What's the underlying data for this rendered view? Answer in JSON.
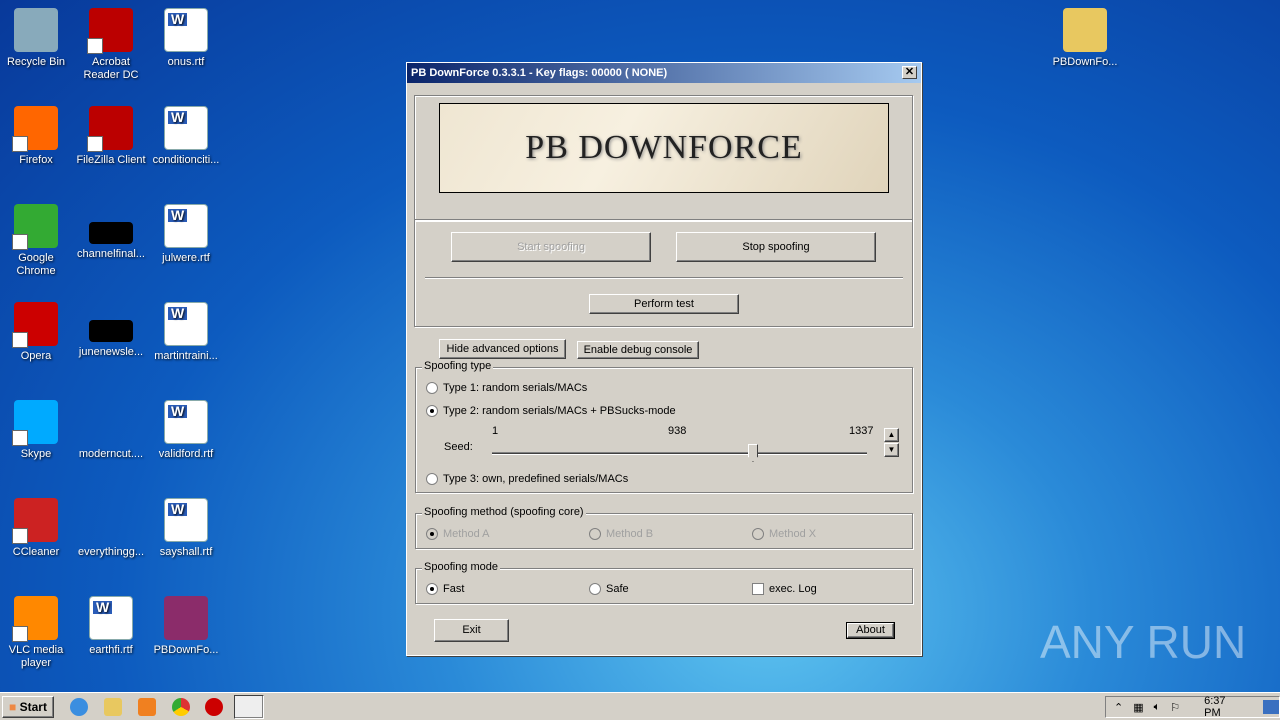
{
  "desktop": {
    "icons": [
      {
        "label": "Recycle Bin",
        "icon": "recycle-bin-icon",
        "color": "#8ab"
      },
      {
        "label": "Acrobat Reader DC",
        "icon": "acrobat-icon",
        "color": "#b00"
      },
      {
        "label": "onus.rtf",
        "icon": "word-doc-icon"
      },
      {
        "label": "Firefox",
        "icon": "firefox-icon",
        "color": "#f60"
      },
      {
        "label": "FileZilla Client",
        "icon": "filezilla-icon",
        "color": "#b00"
      },
      {
        "label": "conditionciti...",
        "icon": "word-doc-icon"
      },
      {
        "label": "Google Chrome",
        "icon": "chrome-icon",
        "color": "#3a3"
      },
      {
        "label": "channelfinal...",
        "icon": "black-file-icon",
        "color": "#000"
      },
      {
        "label": "julwere.rtf",
        "icon": "word-doc-icon"
      },
      {
        "label": "Opera",
        "icon": "opera-icon",
        "color": "#c00"
      },
      {
        "label": "junenewsle...",
        "icon": "black-file-icon",
        "color": "#000"
      },
      {
        "label": "martintraini...",
        "icon": "word-doc-icon"
      },
      {
        "label": "Skype",
        "icon": "skype-icon",
        "color": "#0af"
      },
      {
        "label": "moderncut....",
        "icon": "blank-file-icon"
      },
      {
        "label": "validford.rtf",
        "icon": "word-doc-icon"
      },
      {
        "label": "CCleaner",
        "icon": "ccleaner-icon",
        "color": "#c22"
      },
      {
        "label": "everythingg...",
        "icon": "blank-file-icon"
      },
      {
        "label": "sayshall.rtf",
        "icon": "word-doc-icon"
      },
      {
        "label": "VLC media player",
        "icon": "vlc-icon",
        "color": "#f80"
      },
      {
        "label": "earthfi.rtf",
        "icon": "word-doc-icon"
      },
      {
        "label": "PBDownFo...",
        "icon": "winrar-icon",
        "color": "#8b2c6a"
      }
    ],
    "top_right": {
      "label": "PBDownFo...",
      "icon": "folder-icon",
      "color": "#e8c860"
    }
  },
  "window": {
    "title": "PB DownForce 0.3.3.1  -  Key flags: 00000 ( NONE)",
    "banner": "PB DOWNFORCE",
    "start": "Start spoofing",
    "stop": "Stop spoofing",
    "test": "Perform test",
    "hide_adv": "Hide advanced options",
    "debug": "Enable debug console",
    "type_group": {
      "legend": "Spoofing type",
      "type1": "Type 1: random serials/MACs",
      "type2": "Type 2: random serials/MACs + PBSucks-mode",
      "type3": "Type 3: own, predefined serials/MACs",
      "selected": "type2",
      "seed_label": "Seed:",
      "seed_min": "1",
      "seed_value": "938",
      "seed_max": "1337",
      "seed": 938
    },
    "method_group": {
      "legend": "Spoofing method (spoofing core)",
      "a": "Method A",
      "b": "Method B",
      "x": "Method X",
      "selected": "Method A",
      "disabled": true
    },
    "mode_group": {
      "legend": "Spoofing mode",
      "fast": "Fast",
      "safe": "Safe",
      "log": "exec. Log",
      "selected": "Fast",
      "log_checked": false
    },
    "exit": "Exit",
    "about": "About"
  },
  "taskbar": {
    "start": "Start",
    "clock": "6:37 PM",
    "watermark": "ANY RUN"
  }
}
